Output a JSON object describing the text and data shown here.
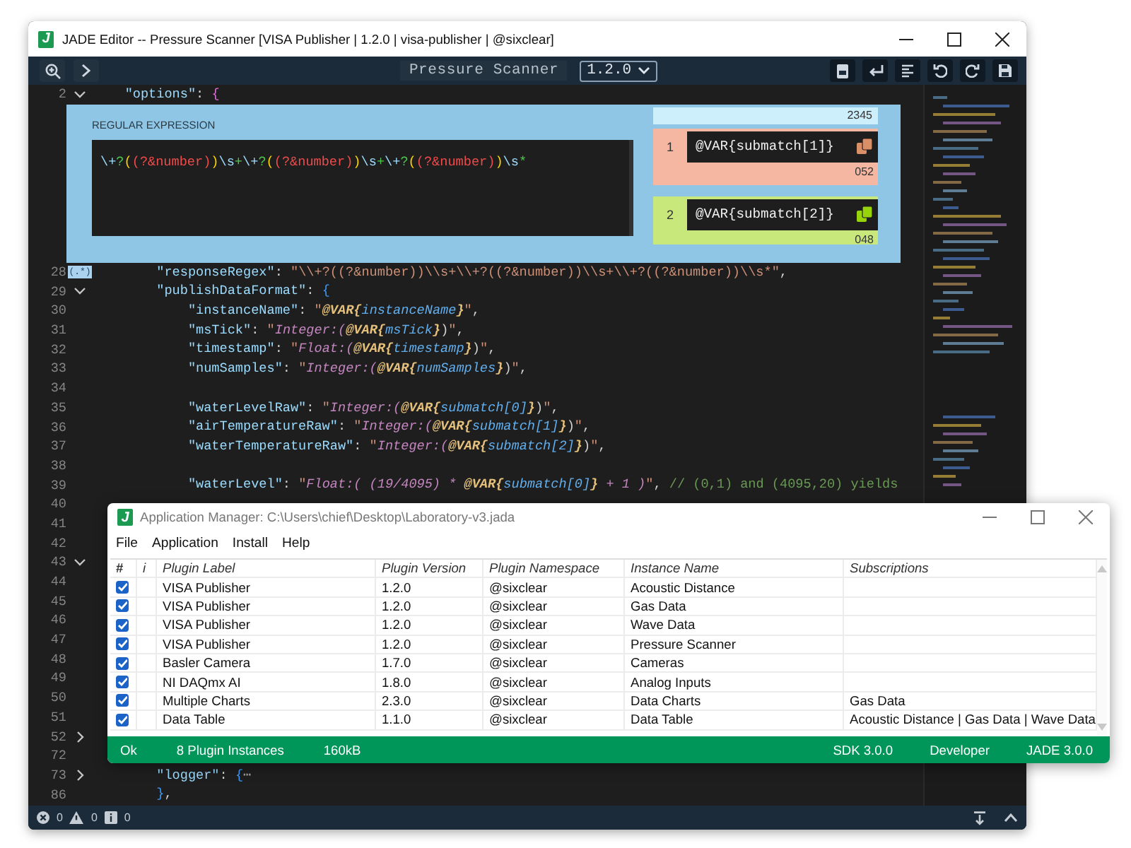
{
  "editor": {
    "logo_letter": "J",
    "title": "JADE Editor -- Pressure Scanner [VISA Publisher | 1.2.0 | visa-publisher | @sixclear]",
    "toolbar": {
      "document_title": "Pressure Scanner",
      "version": "1.2.0"
    },
    "first_lines": [
      {
        "number": "2",
        "expanded": true,
        "segments": [
          {
            "kind": "key",
            "text": "    \"options\""
          },
          {
            "kind": "punct",
            "text": ": "
          },
          {
            "kind": "brace",
            "text": "{"
          }
        ]
      }
    ],
    "regex_panel": {
      "label": "REGULAR EXPRESSION",
      "tokens": [
        {
          "kind": "escape",
          "text": "\\+"
        },
        {
          "kind": "quantifier",
          "text": "?"
        },
        {
          "kind": "group",
          "text": "("
        },
        {
          "kind": "reference",
          "text": "(?&number)"
        },
        {
          "kind": "group",
          "text": ")"
        },
        {
          "kind": "escape",
          "text": "\\s"
        },
        {
          "kind": "quantifier",
          "text": "+"
        },
        {
          "kind": "escape",
          "text": "\\+"
        },
        {
          "kind": "quantifier",
          "text": "?"
        },
        {
          "kind": "group",
          "text": "("
        },
        {
          "kind": "reference",
          "text": "(?&number)"
        },
        {
          "kind": "group",
          "text": ")"
        },
        {
          "kind": "escape",
          "text": "\\s"
        },
        {
          "kind": "quantifier",
          "text": "+"
        },
        {
          "kind": "escape",
          "text": "\\+"
        },
        {
          "kind": "quantifier",
          "text": "?"
        },
        {
          "kind": "group",
          "text": "("
        },
        {
          "kind": "reference",
          "text": "(?&number)"
        },
        {
          "kind": "group",
          "text": ")"
        },
        {
          "kind": "escape",
          "text": "\\s"
        },
        {
          "kind": "quantifier",
          "text": "*"
        }
      ],
      "full_match": {
        "value": "2345",
        "color": "#cdeefb"
      },
      "matches": [
        {
          "index": "1",
          "expression": "@VAR{submatch[1]}",
          "value": "052",
          "color": "#f5b7a1"
        },
        {
          "index": "2",
          "expression": "@VAR{submatch[2]}",
          "value": "048",
          "color": "#c8e87c"
        }
      ]
    },
    "lines": [
      {
        "number": "28",
        "badge": "(.*)",
        "segments": [
          {
            "kind": "key",
            "text": "        \"responseRegex\""
          },
          {
            "kind": "punct",
            "text": ": "
          },
          {
            "kind": "string",
            "text": "\"\\\\+?((?&number))\\\\s+\\\\+?((?&number))\\\\s+\\\\+?((?&number))\\\\s*\""
          },
          {
            "kind": "punct",
            "text": ","
          }
        ]
      },
      {
        "number": "29",
        "expanded": true,
        "segments": [
          {
            "kind": "key",
            "text": "        \"publishDataFormat\""
          },
          {
            "kind": "punct",
            "text": ": "
          },
          {
            "kind": "brace2",
            "text": "{"
          }
        ]
      },
      {
        "number": "30",
        "segments": [
          {
            "kind": "key",
            "text": "            \"instanceName\""
          },
          {
            "kind": "punct",
            "text": ": "
          },
          {
            "kind": "string",
            "text": "\""
          },
          {
            "kind": "var",
            "text": "@VAR{"
          },
          {
            "kind": "name",
            "text": "instanceName"
          },
          {
            "kind": "var",
            "text": "}"
          },
          {
            "kind": "string",
            "text": "\""
          },
          {
            "kind": "punct",
            "text": ","
          }
        ]
      },
      {
        "number": "31",
        "segments": [
          {
            "kind": "key",
            "text": "            \"msTick\""
          },
          {
            "kind": "punct",
            "text": ": "
          },
          {
            "kind": "string",
            "text": "\""
          },
          {
            "kind": "type",
            "text": "Integer:("
          },
          {
            "kind": "var",
            "text": "@VAR{"
          },
          {
            "kind": "name",
            "text": "msTick"
          },
          {
            "kind": "var",
            "text": "}"
          },
          {
            "kind": "punct",
            "text": ")"
          },
          {
            "kind": "string",
            "text": "\""
          },
          {
            "kind": "punct",
            "text": ","
          }
        ]
      },
      {
        "number": "32",
        "segments": [
          {
            "kind": "key",
            "text": "            \"timestamp\""
          },
          {
            "kind": "punct",
            "text": ": "
          },
          {
            "kind": "string",
            "text": "\""
          },
          {
            "kind": "type",
            "text": "Float:("
          },
          {
            "kind": "var",
            "text": "@VAR{"
          },
          {
            "kind": "name",
            "text": "timestamp"
          },
          {
            "kind": "var",
            "text": "}"
          },
          {
            "kind": "punct",
            "text": ")"
          },
          {
            "kind": "string",
            "text": "\""
          },
          {
            "kind": "punct",
            "text": ","
          }
        ]
      },
      {
        "number": "33",
        "segments": [
          {
            "kind": "key",
            "text": "            \"numSamples\""
          },
          {
            "kind": "punct",
            "text": ": "
          },
          {
            "kind": "string",
            "text": "\""
          },
          {
            "kind": "type",
            "text": "Integer:("
          },
          {
            "kind": "var",
            "text": "@VAR{"
          },
          {
            "kind": "name",
            "text": "numSamples"
          },
          {
            "kind": "var",
            "text": "}"
          },
          {
            "kind": "punct",
            "text": ")"
          },
          {
            "kind": "string",
            "text": "\""
          },
          {
            "kind": "punct",
            "text": ","
          }
        ]
      },
      {
        "number": "34"
      },
      {
        "number": "35",
        "segments": [
          {
            "kind": "key",
            "text": "            \"waterLevelRaw\""
          },
          {
            "kind": "punct",
            "text": ": "
          },
          {
            "kind": "string",
            "text": "\""
          },
          {
            "kind": "type",
            "text": "Integer:("
          },
          {
            "kind": "var",
            "text": "@VAR{"
          },
          {
            "kind": "name",
            "text": "submatch[0]"
          },
          {
            "kind": "var",
            "text": "}"
          },
          {
            "kind": "punct",
            "text": ")"
          },
          {
            "kind": "string",
            "text": "\""
          },
          {
            "kind": "punct",
            "text": ","
          }
        ]
      },
      {
        "number": "36",
        "segments": [
          {
            "kind": "key",
            "text": "            \"airTemperatureRaw\""
          },
          {
            "kind": "punct",
            "text": ": "
          },
          {
            "kind": "string",
            "text": "\""
          },
          {
            "kind": "type",
            "text": "Integer:("
          },
          {
            "kind": "var",
            "text": "@VAR{"
          },
          {
            "kind": "name",
            "text": "submatch[1]"
          },
          {
            "kind": "var",
            "text": "}"
          },
          {
            "kind": "punct",
            "text": ")"
          },
          {
            "kind": "string",
            "text": "\""
          },
          {
            "kind": "punct",
            "text": ","
          }
        ]
      },
      {
        "number": "37",
        "segments": [
          {
            "kind": "key",
            "text": "            \"waterTemperatureRaw\""
          },
          {
            "kind": "punct",
            "text": ": "
          },
          {
            "kind": "string",
            "text": "\""
          },
          {
            "kind": "type",
            "text": "Integer:("
          },
          {
            "kind": "var",
            "text": "@VAR{"
          },
          {
            "kind": "name",
            "text": "submatch[2]"
          },
          {
            "kind": "var",
            "text": "}"
          },
          {
            "kind": "punct",
            "text": ")"
          },
          {
            "kind": "string",
            "text": "\""
          },
          {
            "kind": "punct",
            "text": ","
          }
        ]
      },
      {
        "number": "38"
      },
      {
        "number": "39",
        "segments": [
          {
            "kind": "key",
            "text": "            \"waterLevel\""
          },
          {
            "kind": "punct",
            "text": ": "
          },
          {
            "kind": "string",
            "text": "\""
          },
          {
            "kind": "type",
            "text": "Float:( (19/4095) * "
          },
          {
            "kind": "var",
            "text": "@VAR{"
          },
          {
            "kind": "name",
            "text": "submatch[0]"
          },
          {
            "kind": "var",
            "text": "}"
          },
          {
            "kind": "type",
            "text": " + 1 )"
          },
          {
            "kind": "string",
            "text": "\""
          },
          {
            "kind": "punct",
            "text": ", "
          },
          {
            "kind": "comment",
            "text": "// (0,1) and (4095,20) yields"
          }
        ]
      },
      {
        "number": "40"
      },
      {
        "number": "41"
      },
      {
        "number": "42"
      },
      {
        "number": "43",
        "expanded": true
      },
      {
        "number": "44"
      },
      {
        "number": "45"
      },
      {
        "number": "46"
      },
      {
        "number": "47"
      },
      {
        "number": "48"
      },
      {
        "number": "49"
      },
      {
        "number": "50"
      },
      {
        "number": "51"
      },
      {
        "number": "52",
        "expanded": false
      },
      {
        "number": "72"
      },
      {
        "number": "73",
        "expanded": false,
        "segments": [
          {
            "kind": "key",
            "text": "        \"logger\""
          },
          {
            "kind": "punct",
            "text": ": "
          },
          {
            "kind": "brace2",
            "text": "{"
          },
          {
            "kind": "folded",
            "text": "⋯"
          }
        ]
      },
      {
        "number": "86",
        "segments": [
          {
            "kind": "brace2",
            "text": "        }"
          },
          {
            "kind": "punct",
            "text": ","
          }
        ]
      }
    ],
    "status": {
      "errors": "0",
      "warnings": "0",
      "infos": "0"
    }
  },
  "app_manager": {
    "logo_letter": "J",
    "title": "Application Manager: C:\\Users\\chief\\Desktop\\Laboratory-v3.jada",
    "menu": [
      "File",
      "Application",
      "Install",
      "Help"
    ],
    "columns": [
      "#",
      "i",
      "Plugin Label",
      "Plugin Version",
      "Plugin Namespace",
      "Instance Name",
      "Subscriptions"
    ],
    "rows": [
      {
        "checked": true,
        "label": "VISA Publisher",
        "version": "1.2.0",
        "namespace": "@sixclear",
        "instance": "Acoustic Distance"
      },
      {
        "checked": true,
        "label": "VISA Publisher",
        "version": "1.2.0",
        "namespace": "@sixclear",
        "instance": "Gas Data"
      },
      {
        "checked": true,
        "label": "VISA Publisher",
        "version": "1.2.0",
        "namespace": "@sixclear",
        "instance": "Wave Data"
      },
      {
        "checked": true,
        "label": "VISA Publisher",
        "version": "1.2.0",
        "namespace": "@sixclear",
        "instance": "Pressure Scanner"
      },
      {
        "checked": true,
        "label": "Basler Camera",
        "version": "1.7.0",
        "namespace": "@sixclear",
        "instance": "Cameras"
      },
      {
        "checked": true,
        "label": "NI DAQmx AI",
        "version": "1.8.0",
        "namespace": "@sixclear",
        "instance": "Analog Inputs"
      },
      {
        "checked": true,
        "label": "Multiple Charts",
        "version": "2.3.0",
        "namespace": "@sixclear",
        "instance": "Data Charts",
        "subscriptions": "Gas Data"
      },
      {
        "checked": true,
        "label": "Data Table",
        "version": "1.1.0",
        "namespace": "@sixclear",
        "instance": "Data Table",
        "subscriptions": "Acoustic Distance | Gas Data | Wave Data"
      }
    ],
    "status_left": [
      "Ok",
      "8 Plugin Instances",
      "160kB"
    ],
    "status_right": [
      "SDK 3.0.0",
      "Developer",
      "JADE 3.0.0"
    ]
  }
}
